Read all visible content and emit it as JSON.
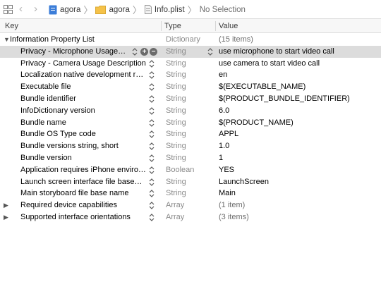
{
  "jumpbar": {
    "crumbs": [
      "agora",
      "agora",
      "Info.plist",
      "No Selection"
    ]
  },
  "columns": {
    "key": "Key",
    "type": "Type",
    "value": "Value"
  },
  "rows": [
    {
      "key": "Information Property List",
      "type": "Dictionary",
      "value": "(15 items)",
      "level": 0,
      "expander": "open"
    },
    {
      "key": "Privacy - Microphone Usage…",
      "type": "String",
      "value": "use microphone to start video call",
      "level": 1,
      "selected": true
    },
    {
      "key": "Privacy - Camera Usage Description",
      "type": "String",
      "value": "use camera to start video call",
      "level": 1
    },
    {
      "key": "Localization native development re…",
      "type": "String",
      "value": "en",
      "level": 1
    },
    {
      "key": "Executable file",
      "type": "String",
      "value": "$(EXECUTABLE_NAME)",
      "level": 1
    },
    {
      "key": "Bundle identifier",
      "type": "String",
      "value": "$(PRODUCT_BUNDLE_IDENTIFIER)",
      "level": 1
    },
    {
      "key": "InfoDictionary version",
      "type": "String",
      "value": "6.0",
      "level": 1
    },
    {
      "key": "Bundle name",
      "type": "String",
      "value": "$(PRODUCT_NAME)",
      "level": 1
    },
    {
      "key": "Bundle OS Type code",
      "type": "String",
      "value": "APPL",
      "level": 1
    },
    {
      "key": "Bundle versions string, short",
      "type": "String",
      "value": "1.0",
      "level": 1
    },
    {
      "key": "Bundle version",
      "type": "String",
      "value": "1",
      "level": 1
    },
    {
      "key": "Application requires iPhone enviro…",
      "type": "Boolean",
      "value": "YES",
      "level": 1
    },
    {
      "key": "Launch screen interface file base…",
      "type": "String",
      "value": "LaunchScreen",
      "level": 1
    },
    {
      "key": "Main storyboard file base name",
      "type": "String",
      "value": "Main",
      "level": 1
    },
    {
      "key": "Required device capabilities",
      "type": "Array",
      "value": "(1 item)",
      "level": 1,
      "expander": "closed"
    },
    {
      "key": "Supported interface orientations",
      "type": "Array",
      "value": "(3 items)",
      "level": 1,
      "expander": "closed"
    }
  ],
  "icons": {
    "grid": "grid-icon",
    "back": "chevron-left-icon",
    "forward": "chevron-right-icon",
    "folder": "folder-icon",
    "file": "plist-file-icon",
    "folder_color": "#f5c249",
    "project_color": "#3b7dd8"
  }
}
